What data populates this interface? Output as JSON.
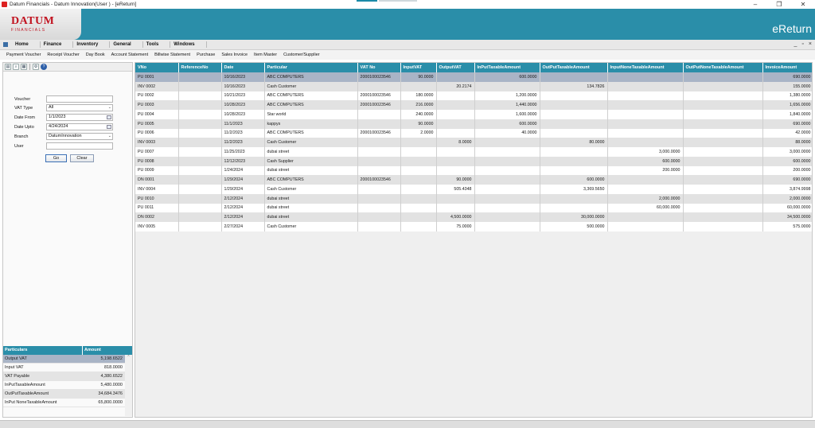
{
  "window": {
    "title": "Datum Financials - Datum Innovation(User   ) - [eReturn]",
    "minimize": "–",
    "restore": "❐",
    "close": "✕"
  },
  "brand": {
    "logo_main": "DATUM",
    "logo_sub": "FINANCIALS",
    "page_title": "eReturn",
    "accent_color": "#2a8ea9",
    "logo_color": "#c1121f"
  },
  "menu": {
    "items": [
      "Home",
      "Finance",
      "Inventory",
      "General",
      "Tools",
      "Windows"
    ],
    "mdi_minimize": "_",
    "mdi_restore": "▫",
    "mdi_close": "×"
  },
  "quick_links": [
    "Payment Voucher",
    "Receipt Voucher",
    "Day Book",
    "Account Statement",
    "Billwise Statement",
    "Purchase",
    "Sales Invoice",
    "Item Master",
    "Customer/Supplier"
  ],
  "toolbar": {
    "icons": [
      "print-icon",
      "search-icon",
      "export-excel-icon",
      "settings-icon",
      "help-icon"
    ]
  },
  "filters": {
    "voucher": {
      "label": "Voucher",
      "value": ""
    },
    "vat_type": {
      "label": "VAT Type",
      "value": "All"
    },
    "date_from": {
      "label": "Date From",
      "value": "1/1/2023"
    },
    "date_upto": {
      "label": "Date Upto",
      "value": "4/24/2024"
    },
    "branch": {
      "label": "Branch",
      "value": "DatumInnovation"
    },
    "user": {
      "label": "User",
      "value": ""
    },
    "go_label": "Go",
    "clear_label": "Clear"
  },
  "summary": {
    "headers": [
      "Particulars",
      "Amount"
    ],
    "rows": [
      [
        "Output VAT",
        "5,198.6522"
      ],
      [
        "Input VAT",
        "818.0000"
      ],
      [
        "VAT Payable",
        "4,380.6522"
      ],
      [
        "InPutTaxableAmount",
        "5,480.0000"
      ],
      [
        "OutPutTaxableAmount",
        "34,684.3476"
      ],
      [
        "InPut NoneTaxableAmount",
        "65,800.0000"
      ]
    ]
  },
  "grid": {
    "headers": [
      "VNo",
      "ReferenceNo",
      "Date",
      "Particular",
      "VAT No",
      "InputVAT",
      "OutputVAT",
      "InPutTaxableAmount",
      "OutPutTaxableAmount",
      "InputNoneTaxableAmount",
      "OutPutNoneTaxableAmount",
      "InvoiceAmount"
    ],
    "rows": [
      [
        "PU 0001",
        "",
        "10/16/2023",
        "ABC COMPUTERS",
        "2000100023546",
        "90.0000",
        "",
        "600.0000",
        "",
        "",
        "",
        "690.0000"
      ],
      [
        "INV 0002",
        "",
        "10/16/2023",
        "Cash Customer",
        "",
        "",
        "20.2174",
        "",
        "134.7826",
        "",
        "",
        "155.0000"
      ],
      [
        "PU 0002",
        "",
        "10/21/2023",
        "ABC COMPUTERS",
        "2000100023546",
        "180.0000",
        "",
        "1,200.0000",
        "",
        "",
        "",
        "1,380.0000"
      ],
      [
        "PU 0003",
        "",
        "10/28/2023",
        "ABC COMPUTERS",
        "2000100023546",
        "216.0000",
        "",
        "1,440.0000",
        "",
        "",
        "",
        "1,656.0000"
      ],
      [
        "PU 0004",
        "",
        "10/28/2023",
        "Star world",
        "",
        "240.0000",
        "",
        "1,600.0000",
        "",
        "",
        "",
        "1,840.0000"
      ],
      [
        "PU 0005",
        "",
        "11/1/2023",
        "kappys",
        "",
        "90.0000",
        "",
        "600.0000",
        "",
        "",
        "",
        "690.0000"
      ],
      [
        "PU 0006",
        "",
        "11/2/2023",
        "ABC COMPUTERS",
        "2000100023546",
        "2.0000",
        "",
        "40.0000",
        "",
        "",
        "",
        "42.0000"
      ],
      [
        "INV 0003",
        "",
        "11/2/2023",
        "Cash Customer",
        "",
        "",
        "8.0000",
        "",
        "80.0000",
        "",
        "",
        "88.0000"
      ],
      [
        "PU 0007",
        "",
        "11/25/2023",
        "dubai street",
        "",
        "",
        "",
        "",
        "",
        "3,000.0000",
        "",
        "3,000.0000"
      ],
      [
        "PU 0008",
        "",
        "12/12/2023",
        "Cash Supplier",
        "",
        "",
        "",
        "",
        "",
        "600.0000",
        "",
        "600.0000"
      ],
      [
        "PU 0009",
        "",
        "1/24/2024",
        "dubai street",
        "",
        "",
        "",
        "",
        "",
        "200.0000",
        "",
        "200.0000"
      ],
      [
        "DN 0001",
        "",
        "1/29/2024",
        "ABC COMPUTERS",
        "2000100023546",
        "",
        "90.0000",
        "",
        "600.0000",
        "",
        "",
        "690.0000"
      ],
      [
        "INV 0004",
        "",
        "1/29/2024",
        "Cash Customer",
        "",
        "",
        "505.4348",
        "",
        "3,369.5650",
        "",
        "",
        "3,874.9998"
      ],
      [
        "PU 0010",
        "",
        "2/12/2024",
        "dubai street",
        "",
        "",
        "",
        "",
        "",
        "2,000.0000",
        "",
        "2,000.0000"
      ],
      [
        "PU 0011",
        "",
        "2/12/2024",
        "dubai street",
        "",
        "",
        "",
        "",
        "",
        "60,000.0000",
        "",
        "60,000.0000"
      ],
      [
        "DN 0002",
        "",
        "2/12/2024",
        "dubai street",
        "",
        "",
        "4,500.0000",
        "",
        "30,000.0000",
        "",
        "",
        "34,500.0000"
      ],
      [
        "INV 0005",
        "",
        "2/27/2024",
        "Cash Customer",
        "",
        "",
        "75.0000",
        "",
        "500.0000",
        "",
        "",
        "575.0000"
      ]
    ]
  }
}
